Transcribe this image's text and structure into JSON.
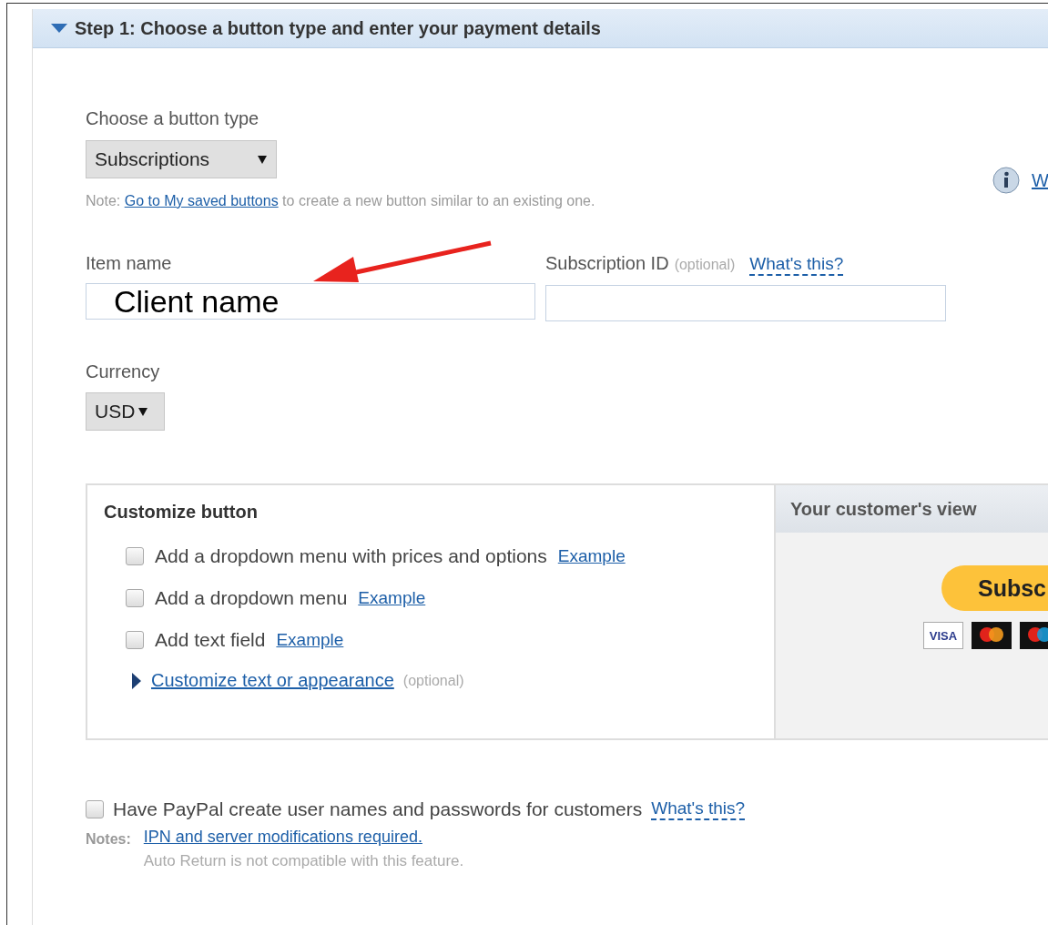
{
  "section": {
    "title": "Step 1: Choose a button type and enter your payment details",
    "expanded": true
  },
  "help_link": "W",
  "button_type": {
    "label": "Choose a button type",
    "value": "Subscriptions"
  },
  "note": {
    "prefix": "Note:",
    "link": "Go to My saved buttons",
    "suffix": "to create a new button similar to an existing one."
  },
  "item_name": {
    "label": "Item name",
    "value": "Client name"
  },
  "subscription_id": {
    "label": "Subscription ID",
    "optional": "(optional)",
    "help": "What's this?"
  },
  "currency": {
    "label": "Currency",
    "value": "USD"
  },
  "customize": {
    "title": "Customize button",
    "options": [
      {
        "label": "Add a dropdown menu with prices and options",
        "link": "Example",
        "checked": false
      },
      {
        "label": "Add a dropdown menu",
        "link": "Example",
        "checked": false
      },
      {
        "label": "Add text field",
        "link": "Example",
        "checked": false
      }
    ],
    "more": {
      "link": "Customize text or appearance",
      "optional": "(optional)",
      "expanded": false
    }
  },
  "preview": {
    "title": "Your customer's view",
    "button": "Subsc",
    "cards": [
      {
        "kind": "visa",
        "label": "VISA"
      },
      {
        "kind": "mastercard"
      },
      {
        "kind": "maestro"
      }
    ]
  },
  "accounts": {
    "label": "Have PayPal create user names and passwords for customers",
    "help": "What's this?",
    "checked": false,
    "notes_label": "Notes:",
    "notes_link": "IPN and server modifications required.",
    "notes_text": "Auto Return is not compatible with this feature."
  }
}
